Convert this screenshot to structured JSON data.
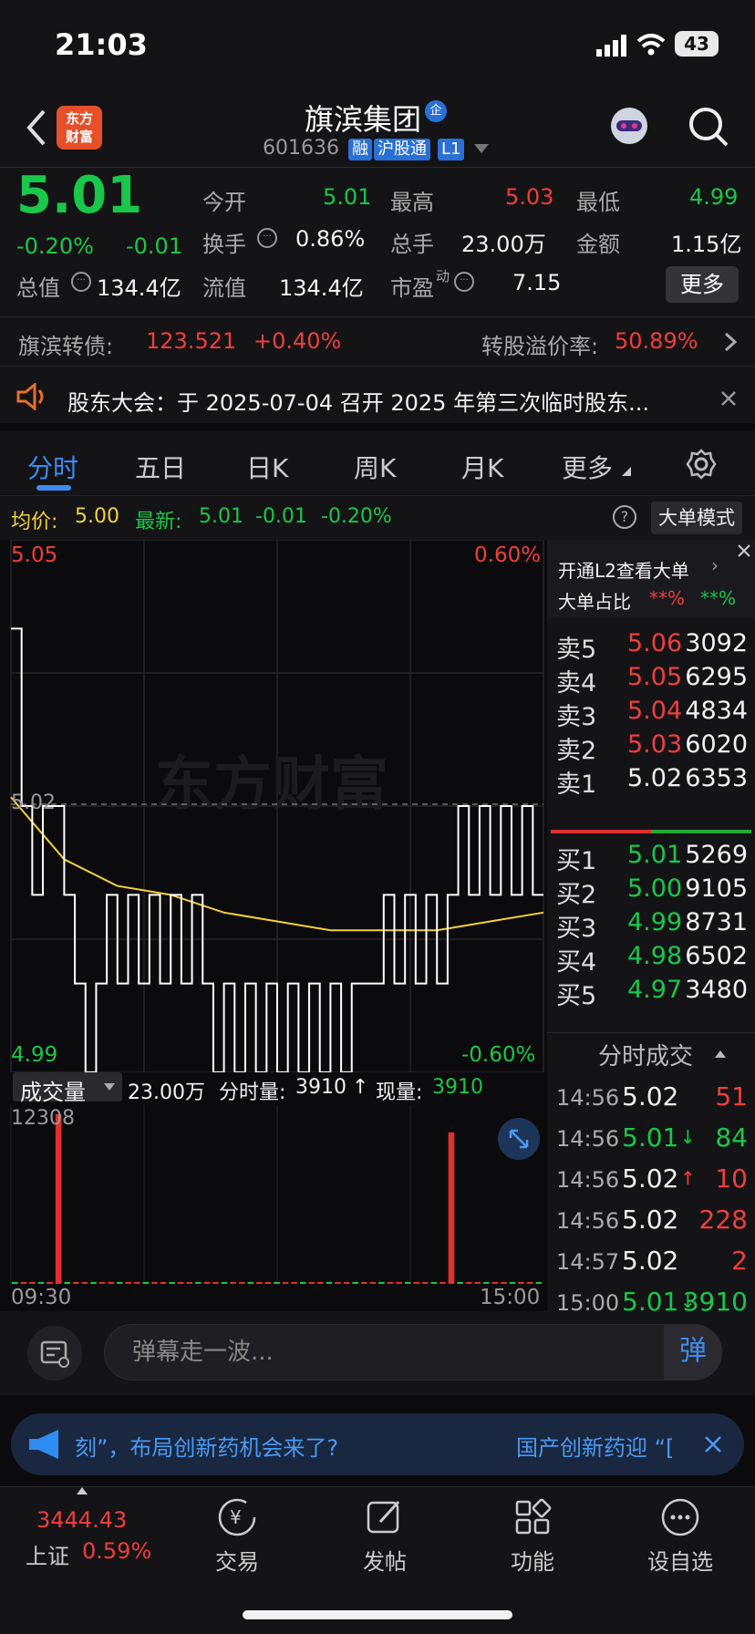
{
  "status_bar": {
    "time": "21:03",
    "battery": "43"
  },
  "header": {
    "logo_line1": "东方",
    "logo_line2": "财富",
    "stock_name": "旗滨集团",
    "stock_code": "601636",
    "tags": [
      "融",
      "沪股通",
      "L1"
    ]
  },
  "quote": {
    "price": "5.01",
    "change_pct": "-0.20%",
    "change": "-0.01",
    "open_label": "今开",
    "open": "5.01",
    "high_label": "最高",
    "high": "5.03",
    "low_label": "最低",
    "low": "4.99",
    "turnover_label": "换手",
    "turnover": "0.86%",
    "volume_label": "总手",
    "volume": "23.00万",
    "amount_label": "金额",
    "amount": "1.15亿",
    "mktcap_label": "总值",
    "mktcap": "134.4亿",
    "float_label": "流值",
    "float_cap": "134.4亿",
    "pe_label": "市盈",
    "pe_sup": "动",
    "pe": "7.15",
    "more_label": "更多"
  },
  "bond": {
    "name": "旗滨转债:",
    "price": "123.521",
    "change": "+0.40%",
    "premium_label": "转股溢价率:",
    "premium": "50.89%"
  },
  "notice": {
    "text": "股东大会：于 2025-07-04 召开 2025 年第三次临时股东..."
  },
  "tabs": [
    {
      "label": "分时"
    },
    {
      "label": "五日"
    },
    {
      "label": "日K"
    },
    {
      "label": "周K"
    },
    {
      "label": "月K"
    },
    {
      "label": "更多"
    }
  ],
  "avg_row": {
    "avg_label": "均价:",
    "avg": "5.00",
    "latest_label": "最新:",
    "latest": "5.01",
    "latest_change": "-0.01",
    "latest_pct": "-0.20%",
    "help": "?",
    "big_order_mode": "大单模式"
  },
  "chart_data": {
    "type": "line",
    "title": "",
    "xlabel": "",
    "ylabel": "",
    "x_range": [
      "09:30",
      "15:00"
    ],
    "ylim": [
      4.99,
      5.05
    ],
    "y_right_labels": [
      "0.60%",
      "-0.60%"
    ],
    "y_top_label": "5.05",
    "y_bottom_label": "4.99",
    "prev_close_label": "5.02",
    "watermark": "东方财富",
    "series": [
      {
        "name": "price",
        "color": "#ffffff",
        "x": [
          0,
          1,
          2,
          3,
          4,
          5,
          6,
          7,
          8,
          9,
          10,
          11,
          12,
          13,
          14,
          15,
          16,
          17,
          18,
          19,
          20,
          21,
          22,
          23,
          24,
          25,
          26,
          27,
          28,
          29,
          30,
          31,
          32,
          33,
          34,
          35,
          36,
          37,
          38,
          39,
          40,
          41,
          42,
          43,
          44,
          45,
          46,
          47,
          48,
          49,
          50
        ],
        "values": [
          5.04,
          5.02,
          5.01,
          5.02,
          5.02,
          5.01,
          5.0,
          4.99,
          5.0,
          5.01,
          5.0,
          5.01,
          5.0,
          5.01,
          5.0,
          5.01,
          5.0,
          5.01,
          5.0,
          4.99,
          5.0,
          4.99,
          5.0,
          4.99,
          5.0,
          4.99,
          5.0,
          4.99,
          5.0,
          4.99,
          5.0,
          4.99,
          5.0,
          5.0,
          5.0,
          5.01,
          5.0,
          5.01,
          5.0,
          5.01,
          5.0,
          5.01,
          5.02,
          5.01,
          5.02,
          5.01,
          5.02,
          5.01,
          5.02,
          5.01,
          5.01
        ]
      },
      {
        "name": "avg",
        "color": "#f2d23a",
        "x": [
          0,
          5,
          10,
          15,
          20,
          25,
          30,
          35,
          40,
          45,
          50
        ],
        "values": [
          5.021,
          5.014,
          5.011,
          5.01,
          5.008,
          5.007,
          5.006,
          5.006,
          5.006,
          5.007,
          5.008
        ]
      }
    ]
  },
  "volume": {
    "label": "成交量",
    "total": "23.00万",
    "minute_vol_label": "分时量:",
    "minute_vol": "3910",
    "now_vol_label": "现量:",
    "now_vol": "3910",
    "max_label": "12308",
    "x_start": "09:30",
    "x_end": "15:00",
    "bars": [
      3,
      8,
      2,
      5,
      1,
      12308,
      6,
      2,
      4,
      9,
      3,
      2,
      7,
      5,
      3,
      2,
      4,
      6,
      2,
      3,
      8,
      4,
      2,
      5,
      3,
      6,
      2,
      4,
      7,
      3,
      9,
      2,
      5,
      3,
      4,
      2,
      6,
      3,
      8,
      2,
      3,
      5,
      2,
      4,
      7,
      3,
      2,
      6,
      4,
      5,
      11000,
      2,
      4,
      3,
      6,
      2,
      3,
      5,
      8,
      2,
      4
    ]
  },
  "l2": {
    "promo": "开通L2查看大单",
    "ratio_label": "大单占比",
    "ratio_red": "**%",
    "ratio_green": "**%"
  },
  "orderbook": {
    "asks": [
      {
        "label": "卖5",
        "price": "5.06",
        "vol": "3092"
      },
      {
        "label": "卖4",
        "price": "5.05",
        "vol": "6295"
      },
      {
        "label": "卖3",
        "price": "5.04",
        "vol": "4834"
      },
      {
        "label": "卖2",
        "price": "5.03",
        "vol": "6020"
      },
      {
        "label": "卖1",
        "price": "5.02",
        "vol": "6353"
      }
    ],
    "bids": [
      {
        "label": "买1",
        "price": "5.01",
        "vol": "5269"
      },
      {
        "label": "买2",
        "price": "5.00",
        "vol": "9105"
      },
      {
        "label": "买3",
        "price": "4.99",
        "vol": "8731"
      },
      {
        "label": "买4",
        "price": "4.98",
        "vol": "6502"
      },
      {
        "label": "买5",
        "price": "4.97",
        "vol": "3480"
      }
    ]
  },
  "ticks": {
    "title": "分时成交",
    "rows": [
      {
        "time": "14:56",
        "price": "5.02",
        "vol": "51",
        "pc": "white",
        "vc": "red",
        "arrow": ""
      },
      {
        "time": "14:56",
        "price": "5.01",
        "vol": "84",
        "pc": "green",
        "vc": "green",
        "arrow": "↓"
      },
      {
        "time": "14:56",
        "price": "5.02",
        "vol": "10",
        "pc": "white",
        "vc": "red",
        "arrow": "↑"
      },
      {
        "time": "14:56",
        "price": "5.02",
        "vol": "228",
        "pc": "white",
        "vc": "red",
        "arrow": ""
      },
      {
        "time": "14:57",
        "price": "5.02",
        "vol": "2",
        "pc": "white",
        "vc": "red",
        "arrow": ""
      },
      {
        "time": "15:00",
        "price": "5.01",
        "vol": "3910",
        "pc": "green",
        "vc": "green",
        "arrow": "↓"
      }
    ]
  },
  "danmu": {
    "placeholder": "弹幕走一波...",
    "send": "弹"
  },
  "news": {
    "left": "刻”，布局创新药机会来了?",
    "right": "国产创新药迎 “["
  },
  "navbar": {
    "index_value": "3444.43",
    "index_name": "上证",
    "index_pct": "0.59%",
    "items": [
      "交易",
      "发帖",
      "功能",
      "设自选"
    ]
  }
}
